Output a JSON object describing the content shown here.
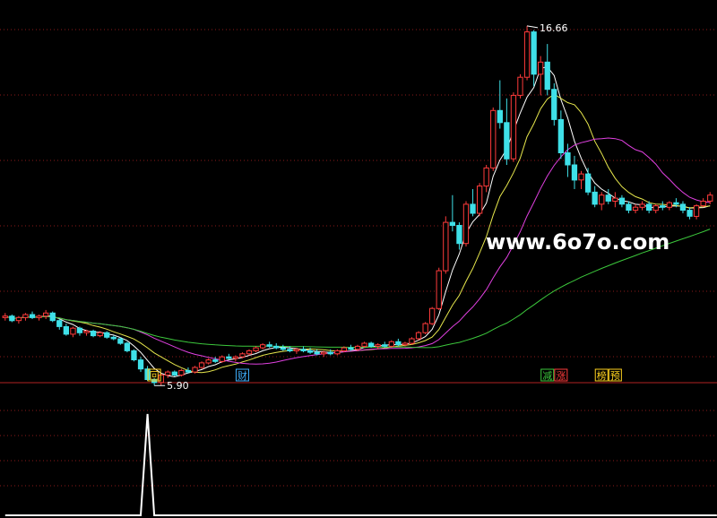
{
  "watermark": "www.6o7o.com",
  "colors": {
    "background": "#000000",
    "grid": "#8b1a1a",
    "divider": "#b22222",
    "up": "#ff3b3b",
    "down": "#3fe0e8",
    "ma_short": "#ffffff",
    "ma_mid": "#e6e64c",
    "ma_long": "#e040e0",
    "ma_longest": "#3cc83c",
    "indicator": "#ffffff"
  },
  "chart_data": [
    {
      "type": "candlestick",
      "title": "",
      "high_label": "16.66",
      "low_label": "5.90",
      "ylim": [
        5.5,
        17.3
      ],
      "grid": true,
      "candles": [
        [
          7.15,
          7.3,
          7.05,
          7.2
        ],
        [
          7.2,
          7.25,
          7.0,
          7.05
        ],
        [
          7.05,
          7.2,
          6.95,
          7.15
        ],
        [
          7.15,
          7.3,
          7.05,
          7.25
        ],
        [
          7.25,
          7.35,
          7.1,
          7.15
        ],
        [
          7.15,
          7.25,
          7.05,
          7.2
        ],
        [
          7.2,
          7.4,
          7.1,
          7.3
        ],
        [
          7.3,
          7.35,
          7.0,
          7.05
        ],
        [
          7.05,
          7.1,
          6.75,
          6.85
        ],
        [
          6.85,
          6.95,
          6.55,
          6.6
        ],
        [
          6.6,
          6.85,
          6.5,
          6.8
        ],
        [
          6.8,
          6.85,
          6.55,
          6.65
        ],
        [
          6.65,
          6.75,
          6.55,
          6.7
        ],
        [
          6.7,
          6.75,
          6.5,
          6.55
        ],
        [
          6.55,
          6.7,
          6.5,
          6.65
        ],
        [
          6.65,
          6.7,
          6.45,
          6.5
        ],
        [
          6.5,
          6.55,
          6.4,
          6.45
        ],
        [
          6.45,
          6.5,
          6.25,
          6.3
        ],
        [
          6.3,
          6.35,
          6.0,
          6.05
        ],
        [
          6.05,
          6.1,
          5.7,
          5.75
        ],
        [
          5.75,
          5.85,
          5.35,
          5.45
        ],
        [
          5.45,
          5.55,
          5.05,
          5.1
        ],
        [
          5.1,
          5.15,
          4.9,
          5.0
        ],
        [
          5.0,
          5.3,
          4.9,
          5.25
        ],
        [
          5.25,
          5.4,
          5.15,
          5.35
        ],
        [
          5.35,
          5.4,
          5.2,
          5.25
        ],
        [
          5.25,
          5.45,
          5.2,
          5.4
        ],
        [
          5.4,
          5.5,
          5.3,
          5.35
        ],
        [
          5.35,
          5.55,
          5.3,
          5.5
        ],
        [
          5.5,
          5.7,
          5.45,
          5.65
        ],
        [
          5.65,
          5.8,
          5.6,
          5.75
        ],
        [
          5.75,
          5.85,
          5.65,
          5.7
        ],
        [
          5.7,
          5.9,
          5.65,
          5.85
        ],
        [
          5.85,
          5.95,
          5.75,
          5.8
        ],
        [
          5.8,
          5.9,
          5.7,
          5.85
        ],
        [
          5.85,
          6.0,
          5.8,
          5.95
        ],
        [
          5.95,
          6.1,
          5.9,
          6.05
        ],
        [
          6.05,
          6.2,
          6.0,
          6.15
        ],
        [
          6.15,
          6.3,
          6.1,
          6.25
        ],
        [
          6.25,
          6.35,
          6.15,
          6.2
        ],
        [
          6.2,
          6.3,
          6.1,
          6.15
        ],
        [
          6.15,
          6.25,
          6.05,
          6.1
        ],
        [
          6.1,
          6.2,
          6.0,
          6.05
        ],
        [
          6.05,
          6.15,
          5.95,
          6.1
        ],
        [
          6.1,
          6.2,
          6.0,
          6.05
        ],
        [
          6.05,
          6.15,
          5.95,
          6.0
        ],
        [
          6.0,
          6.1,
          5.9,
          5.95
        ],
        [
          5.95,
          6.05,
          5.85,
          6.0
        ],
        [
          6.0,
          6.1,
          5.9,
          5.95
        ],
        [
          5.95,
          6.1,
          5.9,
          6.05
        ],
        [
          6.05,
          6.2,
          6.0,
          6.15
        ],
        [
          6.15,
          6.25,
          6.05,
          6.1
        ],
        [
          6.1,
          6.25,
          6.05,
          6.2
        ],
        [
          6.2,
          6.35,
          6.15,
          6.3
        ],
        [
          6.3,
          6.35,
          6.15,
          6.2
        ],
        [
          6.2,
          6.3,
          6.1,
          6.25
        ],
        [
          6.25,
          6.35,
          6.15,
          6.2
        ],
        [
          6.2,
          6.4,
          6.15,
          6.35
        ],
        [
          6.35,
          6.45,
          6.2,
          6.25
        ],
        [
          6.25,
          6.35,
          6.2,
          6.3
        ],
        [
          6.3,
          6.5,
          6.25,
          6.45
        ],
        [
          6.45,
          6.7,
          6.4,
          6.65
        ],
        [
          6.65,
          7.0,
          6.6,
          6.95
        ],
        [
          6.95,
          7.5,
          6.9,
          7.45
        ],
        [
          7.45,
          8.8,
          7.4,
          8.7
        ],
        [
          8.7,
          10.5,
          8.6,
          10.3
        ],
        [
          10.3,
          11.2,
          10.0,
          10.2
        ],
        [
          10.2,
          10.3,
          9.4,
          9.6
        ],
        [
          9.6,
          11.0,
          9.5,
          10.9
        ],
        [
          10.9,
          11.4,
          10.5,
          10.6
        ],
        [
          10.6,
          11.6,
          10.5,
          11.5
        ],
        [
          11.5,
          12.2,
          11.3,
          12.1
        ],
        [
          12.1,
          14.1,
          12.0,
          14.0
        ],
        [
          14.0,
          15.0,
          13.4,
          13.6
        ],
        [
          13.6,
          14.4,
          12.2,
          12.4
        ],
        [
          12.4,
          14.6,
          12.3,
          14.5
        ],
        [
          14.5,
          15.2,
          14.4,
          15.1
        ],
        [
          15.1,
          16.8,
          15.0,
          16.6
        ],
        [
          16.6,
          16.66,
          14.8,
          15.2
        ],
        [
          15.2,
          15.8,
          14.5,
          15.6
        ],
        [
          15.6,
          16.2,
          14.5,
          14.7
        ],
        [
          14.7,
          14.9,
          13.5,
          13.7
        ],
        [
          13.7,
          14.0,
          12.4,
          12.6
        ],
        [
          12.6,
          12.9,
          11.8,
          12.2
        ],
        [
          12.2,
          12.5,
          11.4,
          11.7
        ],
        [
          11.7,
          12.0,
          11.4,
          11.9
        ],
        [
          11.9,
          12.1,
          11.2,
          11.3
        ],
        [
          11.3,
          11.5,
          10.8,
          10.9
        ],
        [
          10.9,
          11.3,
          10.7,
          11.2
        ],
        [
          11.2,
          11.4,
          10.9,
          11.0
        ],
        [
          11.0,
          11.3,
          10.8,
          11.1
        ],
        [
          11.1,
          11.2,
          10.8,
          10.9
        ],
        [
          10.9,
          11.0,
          10.6,
          10.7
        ],
        [
          10.7,
          10.9,
          10.6,
          10.8
        ],
        [
          10.8,
          11.0,
          10.7,
          10.9
        ],
        [
          10.9,
          11.0,
          10.6,
          10.7
        ],
        [
          10.7,
          10.9,
          10.6,
          10.85
        ],
        [
          10.85,
          11.0,
          10.7,
          10.8
        ],
        [
          10.8,
          11.0,
          10.7,
          10.95
        ],
        [
          10.95,
          11.1,
          10.8,
          10.9
        ],
        [
          10.9,
          11.0,
          10.6,
          10.7
        ],
        [
          10.7,
          10.8,
          10.4,
          10.5
        ],
        [
          10.5,
          10.9,
          10.4,
          10.85
        ],
        [
          10.85,
          11.1,
          10.8,
          11.0
        ],
        [
          11.0,
          11.3,
          10.9,
          11.2
        ]
      ],
      "annotations": [
        {
          "text": "回",
          "bar": 22,
          "color": "#ffd21e"
        },
        {
          "text": "财",
          "bar": 35,
          "color": "#3fb0ff"
        },
        {
          "text": "减",
          "bar": 80,
          "color": "#3cc83c"
        },
        {
          "text": "涨",
          "bar": 82,
          "color": "#ff3b3b"
        },
        {
          "text": "榜",
          "bar": 88,
          "color": "#ffd21e"
        },
        {
          "text": "预",
          "bar": 90,
          "color": "#ffd21e"
        }
      ]
    },
    {
      "type": "line",
      "title": "",
      "series": [
        {
          "values": [
            0,
            0,
            0,
            0,
            0,
            0,
            0,
            0,
            0,
            0,
            0,
            0,
            0,
            0,
            0,
            0,
            0,
            0,
            0,
            0,
            0,
            1,
            0,
            0,
            0,
            0,
            0,
            0,
            0,
            0,
            0,
            0,
            0,
            0,
            0,
            0,
            0,
            0,
            0,
            0,
            0,
            0,
            0,
            0,
            0,
            0,
            0,
            0,
            0,
            0,
            0,
            0,
            0,
            0,
            0,
            0,
            0,
            0,
            0,
            0,
            0,
            0,
            0,
            0,
            0,
            0,
            0,
            0,
            0,
            0,
            0,
            0,
            0,
            0,
            0,
            0,
            0,
            0,
            0,
            0,
            0,
            0,
            0,
            0,
            0,
            0,
            0,
            0,
            0,
            0,
            0,
            0,
            0,
            0,
            0,
            0,
            0,
            0,
            0,
            0,
            0,
            0,
            0,
            0,
            0,
            0
          ]
        }
      ],
      "ylim": [
        0,
        1.15
      ]
    }
  ]
}
